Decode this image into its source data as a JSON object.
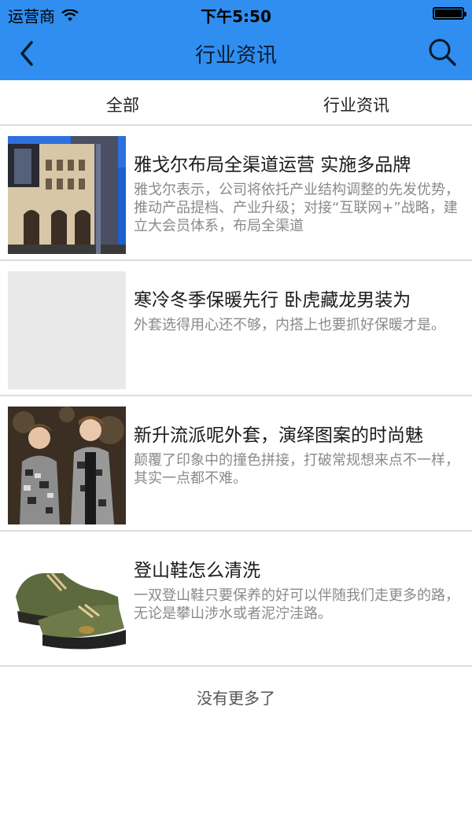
{
  "status_bar": {
    "carrier": "运营商",
    "time": "下午5:50"
  },
  "header": {
    "title": "行业资讯",
    "back_icon": "chevron-left-icon",
    "search_icon": "search-icon"
  },
  "tabs": [
    {
      "label": "全部"
    },
    {
      "label": "行业资讯"
    }
  ],
  "news": [
    {
      "title": "雅戈尔布局全渠道运营 实施多品牌",
      "desc": "雅戈尔表示，公司将依托产业结构调整的先发优势，推动产品提档、产业升级；对接“互联网+”战略，建立大会员体系，布局全渠道"
    },
    {
      "title": "寒冷冬季保暖先行 卧虎藏龙男装为",
      "desc": "外套选得用心还不够，内搭上也要抓好保暖才是。"
    },
    {
      "title": "新升流派呢外套，演绎图案的时尚魅",
      "desc": "颠覆了印象中的撞色拼接，打破常规想来点不一样，其实一点都不难。"
    },
    {
      "title": "登山鞋怎么清洗",
      "desc": "一双登山鞋只要保养的好可以伴随我们走更多的路，无论是攀山涉水或者泥泞洼路。"
    }
  ],
  "footer": {
    "no_more": "没有更多了"
  },
  "colors": {
    "header_bg": "#2f8ef0",
    "divider": "#dddddd"
  }
}
